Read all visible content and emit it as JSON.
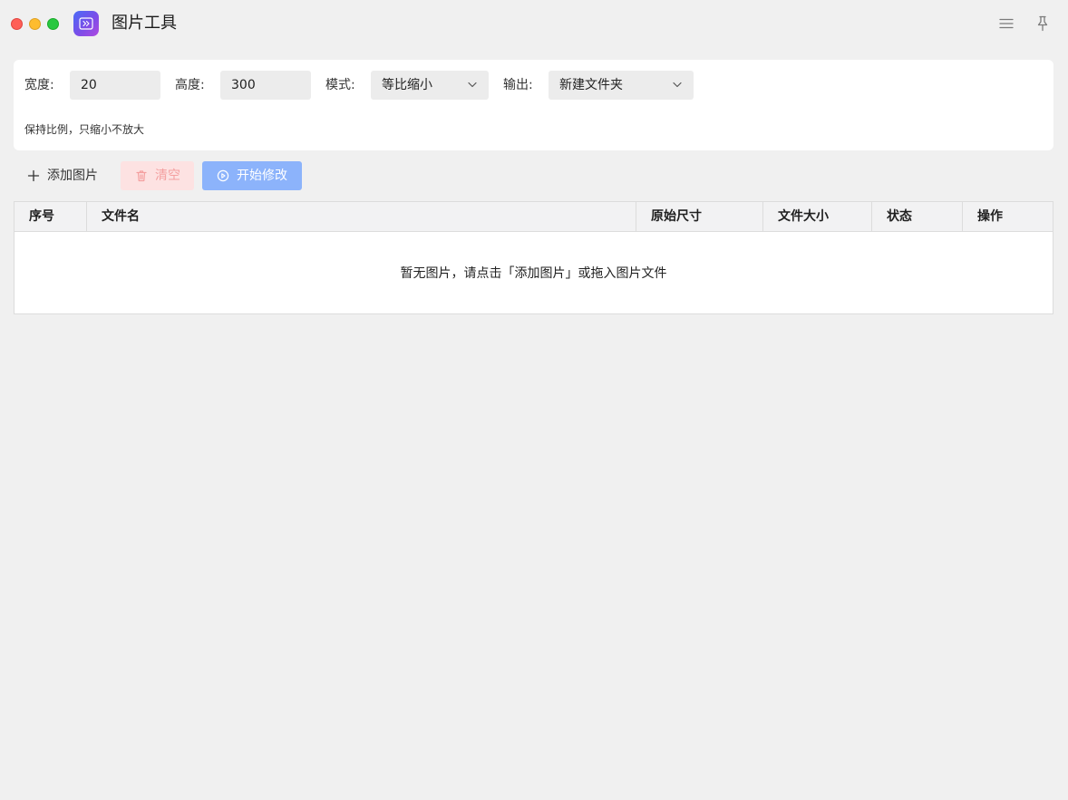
{
  "app": {
    "title": "图片工具",
    "icon": "app-logo-icon"
  },
  "titlebar": {
    "menu_icon": "menu-icon",
    "pin_icon": "pin-icon"
  },
  "settings": {
    "width_label": "宽度:",
    "width_value": "20",
    "height_label": "高度:",
    "height_value": "300",
    "mode_label": "模式:",
    "mode_value": "等比缩小",
    "output_label": "输出:",
    "output_value": "新建文件夹",
    "hint": "保持比例，只缩小不放大"
  },
  "actions": {
    "add_label": "添加图片",
    "clear_label": "清空",
    "start_label": "开始修改"
  },
  "table": {
    "columns": [
      "序号",
      "文件名",
      "原始尺寸",
      "文件大小",
      "状态",
      "操作"
    ],
    "empty_text": "暂无图片，请点击「添加图片」或拖入图片文件"
  },
  "colors": {
    "accent": "#8cb3fb",
    "danger_bg": "#fde2e2",
    "danger_text": "#f4a0a0",
    "window_bg": "#f0f0f0"
  }
}
